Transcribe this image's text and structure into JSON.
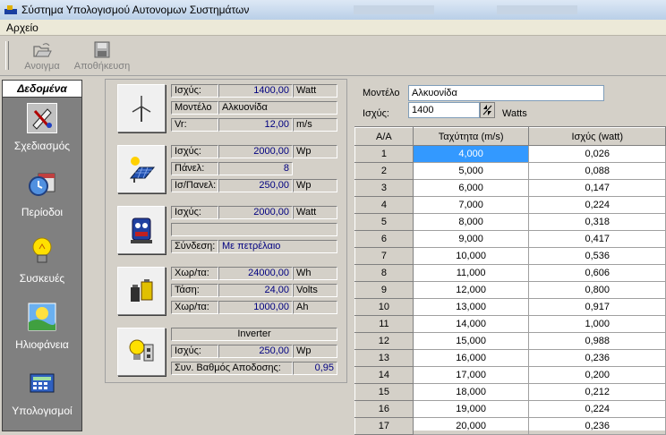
{
  "window": {
    "title": "Σύστημα Υπολογισμού Αυτονομων Συστημάτων"
  },
  "menu": {
    "file": "Αρχείο"
  },
  "toolbar": {
    "open": "Ανοιγμα",
    "save": "Αποθήκευση"
  },
  "sidebar": {
    "header": "Δεδομένα",
    "items": [
      {
        "label": "Σχεδιασμός",
        "icon": "design-tools-icon"
      },
      {
        "label": "Περίοδοι",
        "icon": "calendar-clock-icon"
      },
      {
        "label": "Συσκευές",
        "icon": "lightbulb-icon"
      },
      {
        "label": "Ηλιοφάνεια",
        "icon": "sunshine-icon"
      },
      {
        "label": "Υπολογισμοί",
        "icon": "calculator-icon"
      }
    ]
  },
  "wind": {
    "power_label": "Ισχύς:",
    "power_value": "1400,00",
    "power_unit": "Watt",
    "model_label": "Μοντέλο",
    "model_value": "Αλκυονίδα",
    "vr_label": "Vr:",
    "vr_value": "12,00",
    "vr_unit": "m/s"
  },
  "pv": {
    "power_label": "Ισχύς:",
    "power_value": "2000,00",
    "power_unit": "Wp",
    "panels_label": "Πάνελ:",
    "panels_value": "8",
    "perpanel_label": "Ισ/Πανελ:",
    "perpanel_value": "250,00",
    "perpanel_unit": "Wp"
  },
  "generator": {
    "power_label": "Ισχύς:",
    "power_value": "2000,00",
    "power_unit": "Watt",
    "blank": "",
    "conn_label": "Σύνδεση:",
    "conn_value": "Με πετρέλαιο"
  },
  "battery": {
    "cap_label": "Χωρ/τα:",
    "cap_value": "24000,00",
    "cap_unit": "Wh",
    "volt_label": "Τάση:",
    "volt_value": "24,00",
    "volt_unit": "Volts",
    "ah_label": "Χωρ/τα:",
    "ah_value": "1000,00",
    "ah_unit": "Ah"
  },
  "inverter": {
    "title": "Inverter",
    "power_label": "Ισχύς:",
    "power_value": "250,00",
    "power_unit": "Wp",
    "eff_label": "Συν. Βαθμός Αποδοσης:",
    "eff_value": "0,95"
  },
  "right": {
    "model_label": "Μοντέλο",
    "model_value": "Αλκυονίδα",
    "power_label": "Ισχύς:",
    "power_value": "1400",
    "power_unit": "Watts"
  },
  "table": {
    "headers": [
      "Α/Α",
      "Ταχύτητα (m/s)",
      "Ισχύς (watt)"
    ],
    "rows": [
      [
        "1",
        "4,000",
        "0,026"
      ],
      [
        "2",
        "5,000",
        "0,088"
      ],
      [
        "3",
        "6,000",
        "0,147"
      ],
      [
        "4",
        "7,000",
        "0,224"
      ],
      [
        "5",
        "8,000",
        "0,318"
      ],
      [
        "6",
        "9,000",
        "0,417"
      ],
      [
        "7",
        "10,000",
        "0,536"
      ],
      [
        "8",
        "11,000",
        "0,606"
      ],
      [
        "9",
        "12,000",
        "0,800"
      ],
      [
        "10",
        "13,000",
        "0,917"
      ],
      [
        "11",
        "14,000",
        "1,000"
      ],
      [
        "12",
        "15,000",
        "0,988"
      ],
      [
        "13",
        "16,000",
        "0,236"
      ],
      [
        "14",
        "17,000",
        "0,200"
      ],
      [
        "15",
        "18,000",
        "0,212"
      ],
      [
        "16",
        "19,000",
        "0,224"
      ],
      [
        "17",
        "20,000",
        "0,236"
      ]
    ]
  }
}
